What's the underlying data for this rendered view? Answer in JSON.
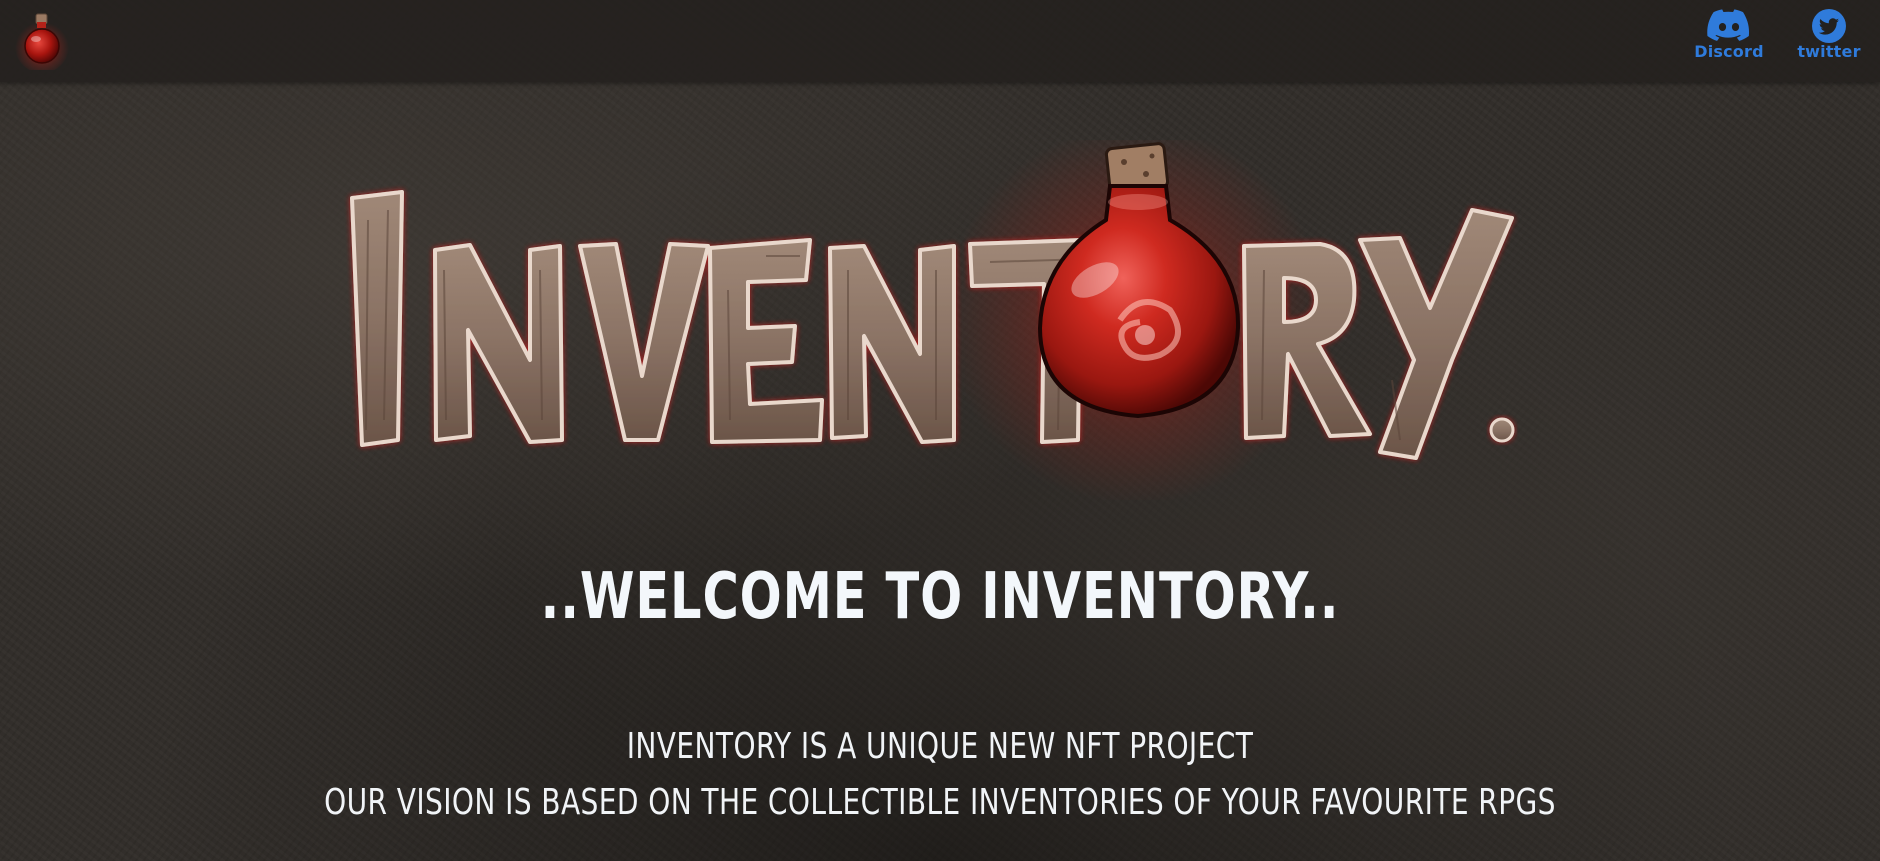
{
  "header": {
    "logo_icon": "potion-icon",
    "social": [
      {
        "label": "Discord",
        "icon": "discord-icon"
      },
      {
        "label": "twitter",
        "icon": "twitter-icon"
      }
    ]
  },
  "hero": {
    "logo_text": "INVENTORY.",
    "logo_icon": "potion-icon"
  },
  "main": {
    "welcome": "..WELCOME TO INVENTORY..",
    "description": [
      "INVENTORY IS A UNIQUE NEW NFT PROJECT",
      "OUR VISION IS BASED ON THE COLLECTIBLE INVENTORIES OF YOUR FAVOURITE RPGS"
    ]
  },
  "colors": {
    "background": "#312d29",
    "accent_red": "#c21f1a",
    "wood": "#8a7264",
    "link_blue": "#2f7bdb",
    "text": "#f3f7fb"
  }
}
